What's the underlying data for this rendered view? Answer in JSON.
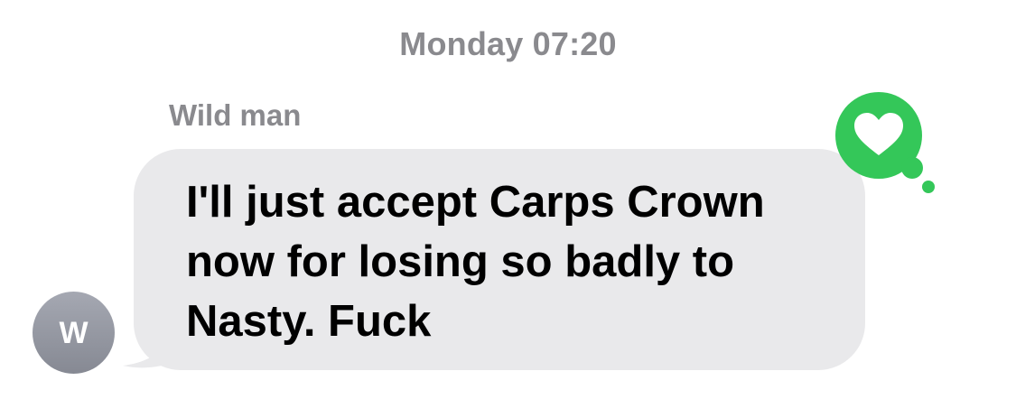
{
  "conversation": {
    "timestamp": "Monday 07:20",
    "message": {
      "sender_name": "Wild man",
      "avatar_initial": "W",
      "text": "I'll just accept Carps Crown now for losing so badly to Nasty. Fuck",
      "reaction": {
        "icon": "heart-icon",
        "color": "#34c759"
      }
    }
  },
  "colors": {
    "bubble_gray": "#e9e9eb",
    "meta_gray": "#8a8a8e",
    "reaction_green": "#34c759"
  }
}
